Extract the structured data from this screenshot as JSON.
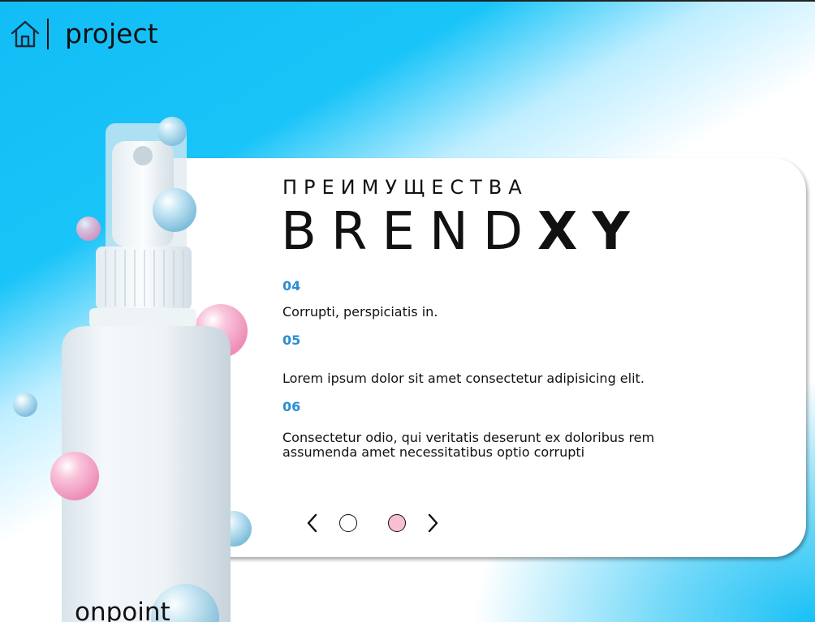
{
  "header": {
    "icon": "home-icon",
    "title": "project"
  },
  "card": {
    "subtitle": "ПРЕИМУЩЕСТВА",
    "title_light": "BREND",
    "title_bold": "XY",
    "items": [
      {
        "number": "04",
        "text": "Corrupti, perspiciatis in."
      },
      {
        "number": "05",
        "text": "Lorem ipsum dolor sit amet consectetur adipisicing elit."
      },
      {
        "number": "06",
        "text": "Consectetur odio, qui veritatis deserunt ex doloribus rem assumenda amet necessitatibus optio corrupti"
      }
    ],
    "slider": {
      "prev_icon": "chevron-left-icon",
      "next_icon": "chevron-right-icon",
      "active_index": 2,
      "active_color": "#f7bfd0"
    }
  },
  "footer": {
    "text": "onpoint"
  },
  "colors": {
    "accent_blue": "#17bff5",
    "number_blue": "#2a8fd4",
    "bubble_pink": "#f4a9c9"
  }
}
